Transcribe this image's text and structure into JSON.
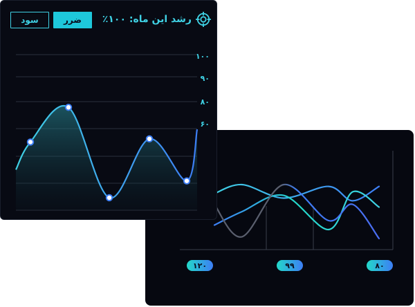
{
  "front_card": {
    "title": "رشد این ماه: ۱۰۰٪",
    "icon": "target-icon",
    "buttons": {
      "loss": "ضرر",
      "profit": "سود"
    },
    "y_ticks": [
      "۱۰۰",
      "۹۰",
      "۸۰",
      "۶۰"
    ]
  },
  "back_card": {
    "pills": [
      "۱۲۰",
      "۹۹",
      "۸۰"
    ]
  },
  "colors": {
    "accent": "#3fd1e4",
    "blue": "#3d7ef5",
    "background": "#080a13"
  },
  "chart_data": [
    {
      "type": "area",
      "title": "",
      "y_ticks": [
        "۱۰۰",
        "۹۰",
        "۸۰",
        "۶۰"
      ],
      "series": [
        {
          "values": [
            55,
            88,
            2,
            58,
            18
          ]
        }
      ],
      "ylim": [
        0,
        100
      ],
      "grid": true
    },
    {
      "type": "line",
      "x_labels": [
        "۱۲۰",
        "۹۹",
        "۸۰"
      ],
      "series": [
        {
          "values": [
            60,
            70,
            55,
            68,
            52,
            68
          ]
        },
        {
          "values": [
            25,
            40,
            58,
            20,
            62,
            45
          ]
        },
        {
          "values": [
            48,
            12,
            70,
            30,
            48,
            10
          ]
        }
      ],
      "grid": true
    }
  ]
}
